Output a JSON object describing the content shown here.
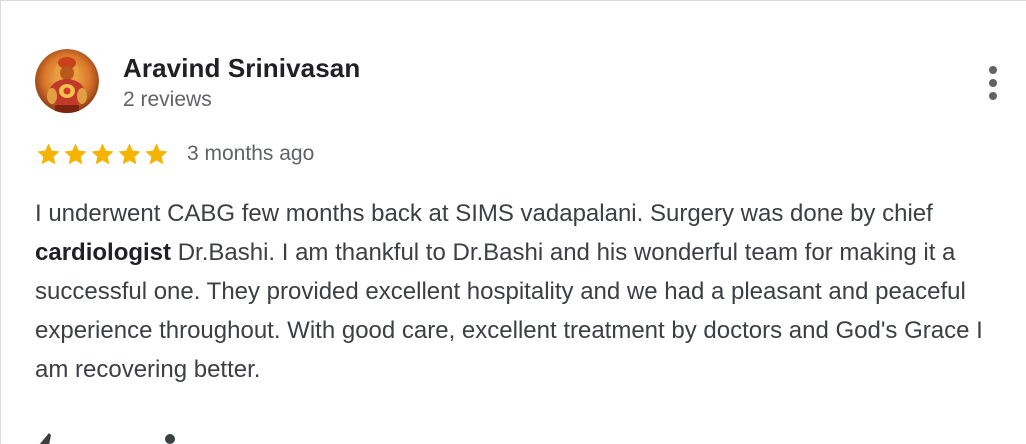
{
  "review": {
    "reviewer": {
      "name": "Aravind Srinivasan",
      "reviews_count": "2 reviews",
      "avatar_icon": "hanuman-portrait-avatar"
    },
    "rating": {
      "stars": 5,
      "max_stars": 5,
      "star_color": "#f4b400",
      "time_ago": "3 months ago"
    },
    "text": {
      "part1": "I underwent CABG few months back at SIMS vadapalani. Surgery was done by chief ",
      "highlight": "cardiologist",
      "part2": " Dr.Bashi. I am thankful to Dr.Bashi and his wonderful team for making it a successful one. They provided excellent hospitality and we had a pleasant and peaceful experience throughout. With good care, excellent treatment by doctors and God's Grace I am recovering better."
    },
    "more_icon": "more-vert-icon",
    "bottom_icons": [
      "thumb-up-icon",
      "share-icon"
    ]
  },
  "colors": {
    "name": "#202124",
    "secondary": "#5f6368",
    "body_text": "#3c4043",
    "border": "#dadce0"
  }
}
